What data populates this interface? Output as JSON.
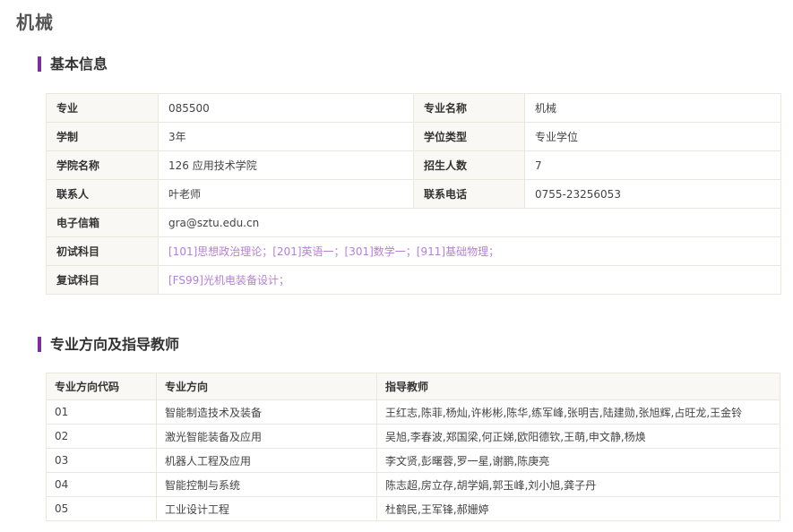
{
  "page": {
    "title": "机械"
  },
  "basic_info": {
    "section_title": "基本信息",
    "rows": [
      [
        {
          "label": "专业",
          "value": "085500"
        },
        {
          "label": "专业名称",
          "value": "机械"
        }
      ],
      [
        {
          "label": "学制",
          "value": "3年"
        },
        {
          "label": "学位类型",
          "value": "专业学位"
        }
      ],
      [
        {
          "label": "学院名称",
          "value": "126 应用技术学院"
        },
        {
          "label": "招生人数",
          "value": "7"
        }
      ],
      [
        {
          "label": "联系人",
          "value": "叶老师"
        },
        {
          "label": "联系电话",
          "value": "0755-23256053"
        }
      ]
    ],
    "email": {
      "label": "电子信箱",
      "value": "gra@sztu.edu.cn"
    },
    "initial_exam": {
      "label": "初试科目",
      "value": "[101]思想政治理论；[201]英语一；[301]数学一；[911]基础物理；"
    },
    "retest": {
      "label": "复试科目",
      "value": "[FS99]光机电装备设计；"
    },
    "link_color": "#b57fd6"
  },
  "directions": {
    "section_title": "专业方向及指导教师",
    "headers": [
      "专业方向代码",
      "专业方向",
      "指导教师"
    ],
    "rows": [
      [
        "01",
        "智能制造技术及装备",
        "王红志,陈菲,杨灿,许彬彬,陈华,练军峰,张明吉,陆建勋,张旭辉,占旺龙,王金铃"
      ],
      [
        "02",
        "激光智能装备及应用",
        "吴旭,李春波,郑国梁,何正娣,欧阳德钦,王萌,申文静,杨焕"
      ],
      [
        "03",
        "机器人工程及应用",
        "李文贤,彭曙蓉,罗一星,谢鹏,陈庚亮"
      ],
      [
        "04",
        "智能控制与系统",
        "陈志超,房立存,胡学娟,郭玉峰,刘小旭,龚子丹"
      ],
      [
        "05",
        "工业设计工程",
        "杜鹤民,王军锋,郝姗婷"
      ]
    ]
  },
  "accent_color": "#7b2f9e"
}
